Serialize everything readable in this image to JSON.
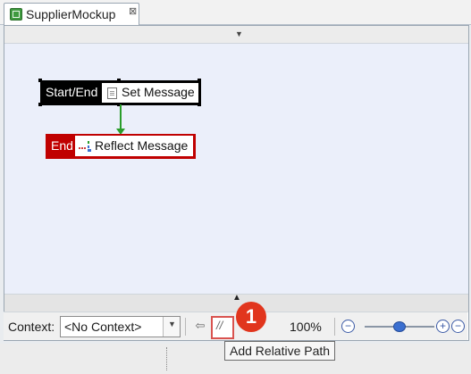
{
  "tab": {
    "title": "SupplierMockup",
    "close_glyph": "⊠"
  },
  "nodes": {
    "start": {
      "type_label": "Start/End",
      "name": "Set Message"
    },
    "end": {
      "type_label": "End",
      "name": "Reflect Message"
    }
  },
  "toolbar": {
    "context_label": "Context:",
    "context_value": "<No Context>",
    "zoom": "100%",
    "zoom_level": 0.5
  },
  "tooltip": "Add Relative Path",
  "badge": "1",
  "icons": [
    "editor-icon",
    "close-icon",
    "document-icon",
    "reflect-icon",
    "back-icon",
    "relative-path-icon",
    "zoom-out-icon",
    "zoom-in-icon",
    "zoom-reset-icon",
    "chevron-down-icon"
  ],
  "colors": {
    "canvas": "#ebeffa",
    "end_node": "#c00000",
    "connector": "#2a9d2a",
    "badge": "#e1351d"
  }
}
